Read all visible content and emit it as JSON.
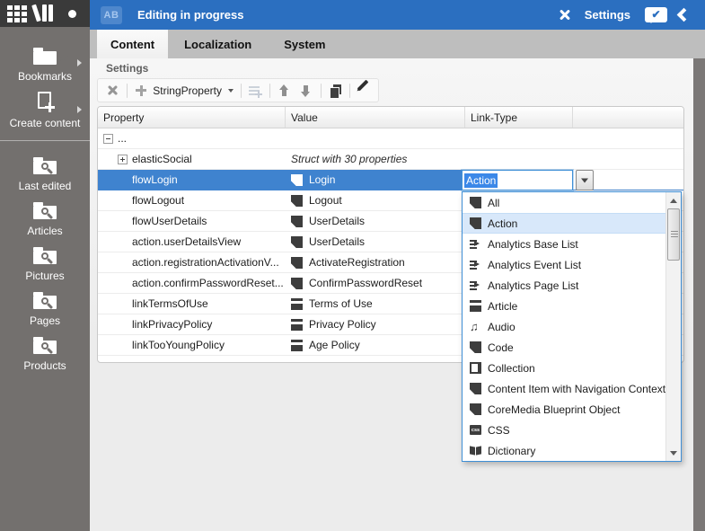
{
  "window": {
    "badge": "AB",
    "title": "Editing in progress"
  },
  "topbar": {
    "settings_label": "Settings",
    "icons": [
      "tools-icon",
      "message-check-icon",
      "collapse-left-icon"
    ]
  },
  "rail": {
    "top_icons": [
      "apps-grid-icon",
      "library-icon",
      "pan-icon"
    ],
    "primary_items": [
      {
        "icon": "folder-star",
        "label": "Bookmarks",
        "has_submenu": "true"
      },
      {
        "icon": "doc-plus",
        "label": "Create content",
        "has_submenu": "true"
      }
    ],
    "search_items": [
      {
        "icon": "folder-search",
        "label": "Last edited"
      },
      {
        "icon": "folder-search",
        "label": "Articles"
      },
      {
        "icon": "folder-search",
        "label": "Pictures"
      },
      {
        "icon": "folder-search",
        "label": "Pages"
      },
      {
        "icon": "folder-search",
        "label": "Products"
      }
    ]
  },
  "tabs": [
    {
      "label": "Content",
      "state": "active"
    },
    {
      "label": "Localization"
    },
    {
      "label": "System"
    }
  ],
  "form": {
    "section_label": "Settings"
  },
  "toolbar": {
    "items": [
      {
        "type": "button",
        "icon": "delete"
      },
      {
        "type": "sep"
      },
      {
        "type": "button",
        "icon": "add",
        "label": "StringProperty",
        "caret": "true"
      },
      {
        "type": "sep"
      },
      {
        "type": "button",
        "icon": "add-row",
        "disabled": "true"
      },
      {
        "type": "sep"
      },
      {
        "type": "button",
        "icon": "move-up"
      },
      {
        "type": "button",
        "icon": "move-down"
      },
      {
        "type": "sep"
      },
      {
        "type": "button",
        "icon": "copy"
      },
      {
        "type": "sep"
      },
      {
        "type": "button",
        "icon": "edit"
      }
    ]
  },
  "table": {
    "columns": [
      {
        "label": "Property"
      },
      {
        "label": "Value"
      },
      {
        "label": "Link-Type"
      }
    ],
    "rows": [
      {
        "name": "...",
        "expander": "minus",
        "indent": "0",
        "value": ""
      },
      {
        "name": "elasticSocial",
        "expander": "plus",
        "indent": "1",
        "value": "Struct with 30 properties",
        "value_style": "italic"
      },
      {
        "name": "flowLogin",
        "indent": "1",
        "value": "Login",
        "value_icon": "action",
        "state": "selected"
      },
      {
        "name": "flowLogout",
        "indent": "1",
        "value": "Logout",
        "value_icon": "action"
      },
      {
        "name": "flowUserDetails",
        "indent": "1",
        "value": "UserDetails",
        "value_icon": "action"
      },
      {
        "name": "action.userDetailsView",
        "indent": "1",
        "value": "UserDetails",
        "value_icon": "action"
      },
      {
        "name": "action.registrationActivationV...",
        "indent": "1",
        "value": "ActivateRegistration",
        "value_icon": "action"
      },
      {
        "name": "action.confirmPasswordReset...",
        "indent": "1",
        "value": "ConfirmPasswordReset",
        "value_icon": "action"
      },
      {
        "name": "linkTermsOfUse",
        "indent": "1",
        "value": "Terms of Use",
        "value_icon": "article"
      },
      {
        "name": "linkPrivacyPolicy",
        "indent": "1",
        "value": "Privacy Policy",
        "value_icon": "article"
      },
      {
        "name": "linkTooYoungPolicy",
        "indent": "1",
        "value": "Age Policy",
        "value_icon": "article"
      }
    ]
  },
  "combo": {
    "value": "Action"
  },
  "dropdown": {
    "items": [
      {
        "icon": "action",
        "label": "All"
      },
      {
        "icon": "action",
        "label": "Action",
        "state": "highlighted"
      },
      {
        "icon": "analytics",
        "label": "Analytics Base List"
      },
      {
        "icon": "analytics",
        "label": "Analytics Event List"
      },
      {
        "icon": "analytics",
        "label": "Analytics Page List"
      },
      {
        "icon": "article",
        "label": "Article"
      },
      {
        "icon": "audio",
        "label": "Audio"
      },
      {
        "icon": "code",
        "label": "Code"
      },
      {
        "icon": "collection",
        "label": "Collection"
      },
      {
        "icon": "action",
        "label": "Content Item with Navigation Context"
      },
      {
        "icon": "action",
        "label": "CoreMedia Blueprint Object"
      },
      {
        "icon": "css",
        "label": "CSS"
      },
      {
        "icon": "dictionary",
        "label": "Dictionary"
      }
    ]
  },
  "colors": {
    "accent_blue": "#2b6fc0",
    "selection_blue": "#3f83cf",
    "rail_gray": "#73706e",
    "rail_top_gray": "#3a3a3a",
    "tabstrip_gray": "#bebebe",
    "dropdown_border_blue": "#3f8fd6"
  }
}
